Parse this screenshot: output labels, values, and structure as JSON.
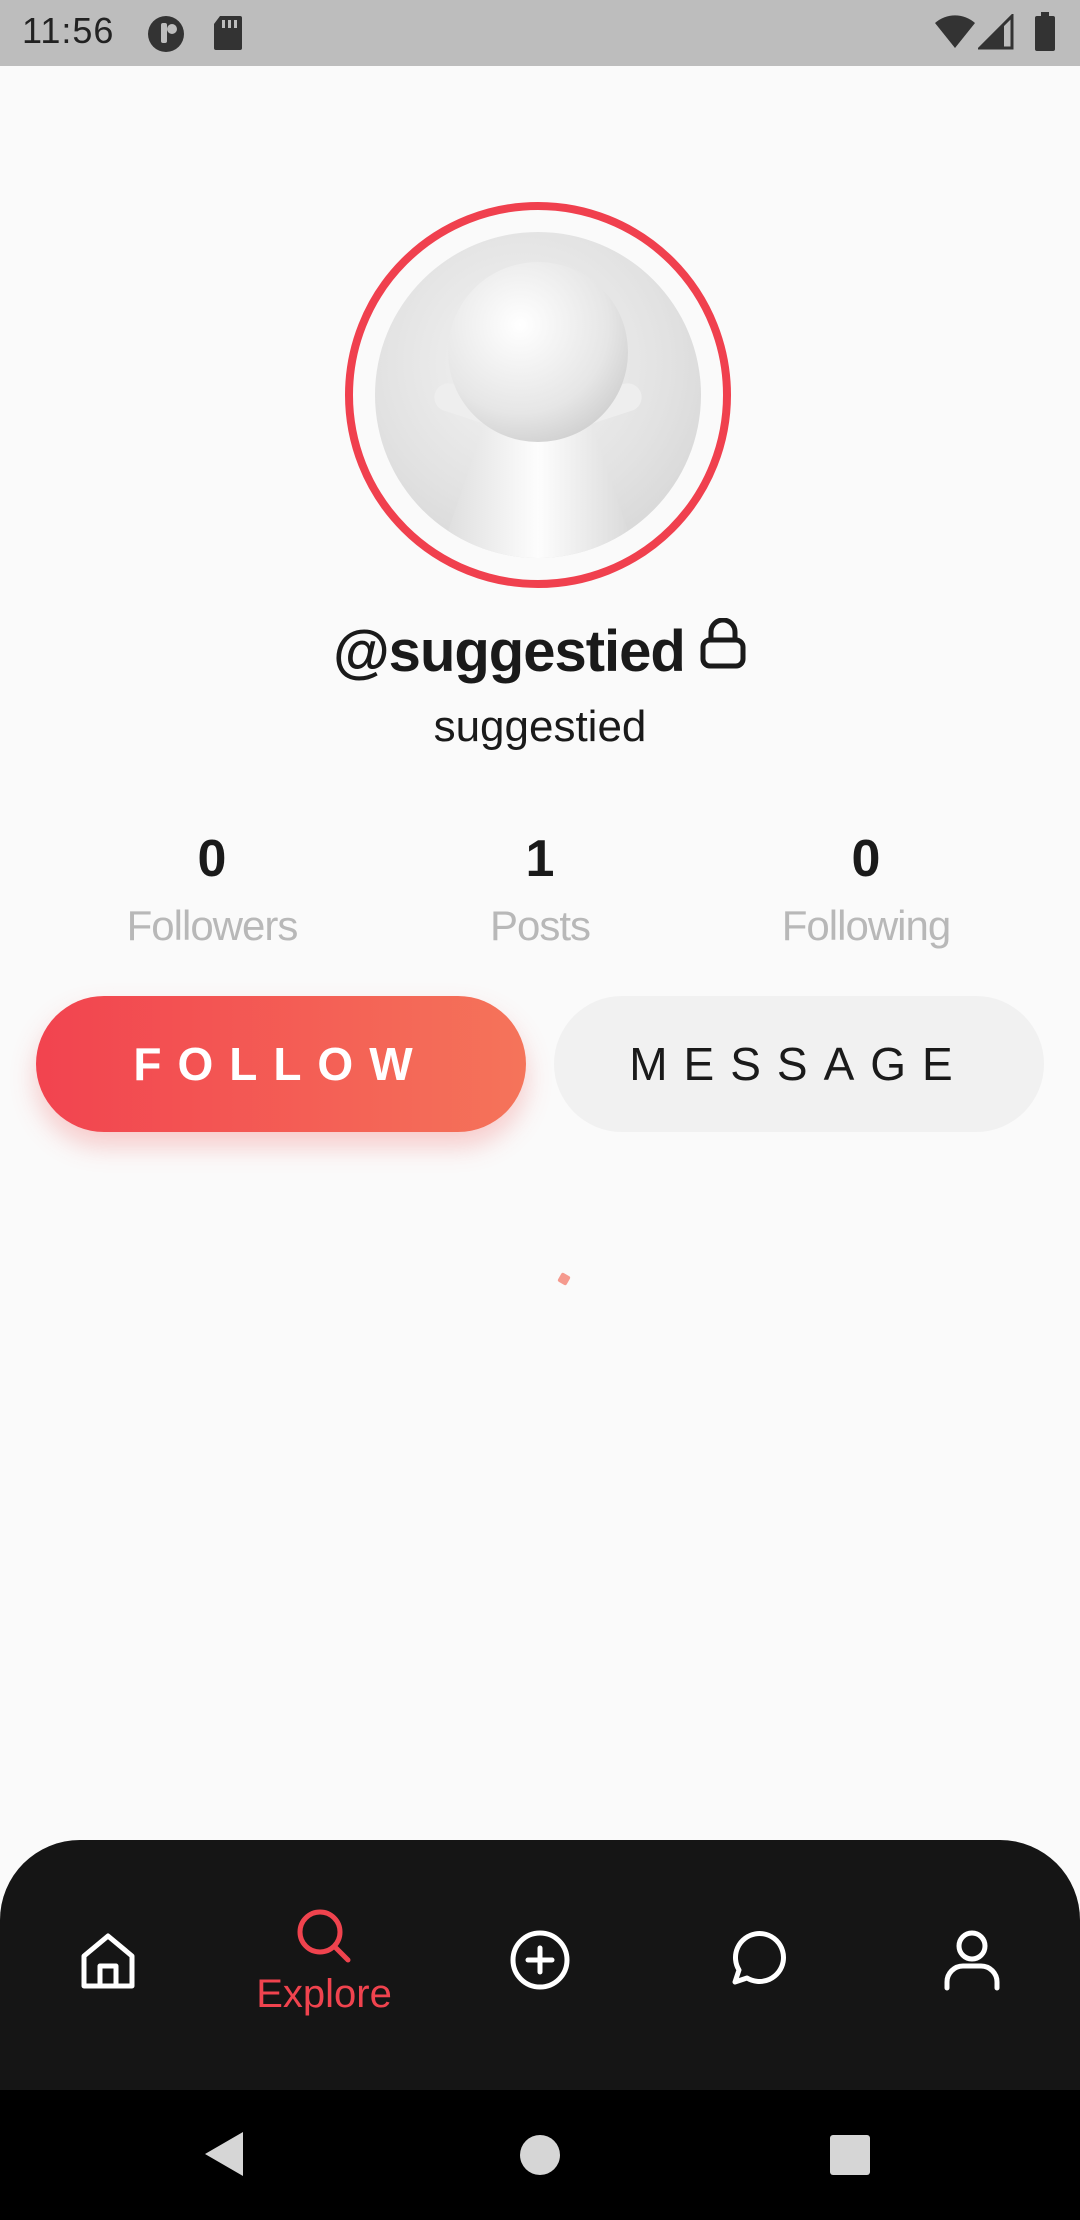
{
  "status_bar": {
    "time": "11:56"
  },
  "profile": {
    "username": "@suggestied",
    "display_name": "suggestied",
    "private": true
  },
  "stats": [
    {
      "value": "0",
      "label": "Followers"
    },
    {
      "value": "1",
      "label": "Posts"
    },
    {
      "value": "0",
      "label": "Following"
    }
  ],
  "actions": {
    "follow_label": "FOLLOW",
    "message_label": "MESSAGE"
  },
  "bottom_nav": {
    "items": [
      {
        "icon": "home-icon"
      },
      {
        "icon": "search-icon",
        "label": "Explore",
        "active": true
      },
      {
        "icon": "plus-circle-icon"
      },
      {
        "icon": "chat-bubble-icon"
      },
      {
        "icon": "user-icon"
      }
    ]
  },
  "colors": {
    "accent": "#f0434e",
    "accent_gradient_end": "#f5745a",
    "nav_background": "#151515",
    "muted_text": "#b8b8b8"
  }
}
